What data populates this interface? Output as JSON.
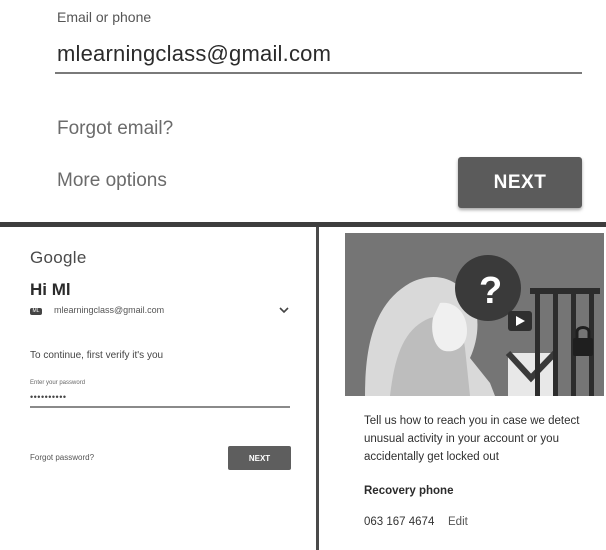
{
  "top": {
    "email_label": "Email or phone",
    "email_value": "mlearningclass@gmail.com",
    "forgot_email": "Forgot email?",
    "more_options": "More options",
    "next_label": "NEXT"
  },
  "signin": {
    "logo": "Google",
    "greeting": "Hi Ml",
    "avatar_text": "ML",
    "account_email": "mlearningclass@gmail.com",
    "verify_text": "To continue, first verify it's you",
    "password_label": "Enter your password",
    "password_value": "••••••••••",
    "forgot_password": "Forgot password?",
    "next_label": "NEXT"
  },
  "recovery": {
    "message": "Tell us how to reach you in case we detect unusual activity in your account or you accidentally get locked out",
    "title": "Recovery phone",
    "phone": "063 167 4674",
    "edit_label": "Edit"
  },
  "icons": {
    "chevron": "chevron-down-icon",
    "illustration": "locked-account-illustration"
  },
  "colors": {
    "button": "#5b5b5b",
    "divider": "#3d3d3d",
    "illustration_bg": "#767676"
  }
}
